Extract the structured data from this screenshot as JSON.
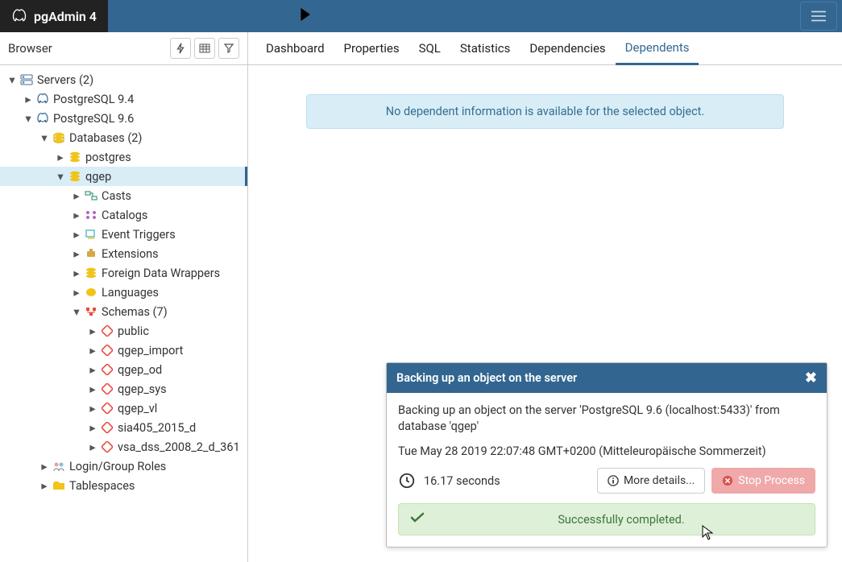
{
  "brand": "pgAdmin 4",
  "browser_title": "Browser",
  "tabs": [
    "Dashboard",
    "Properties",
    "SQL",
    "Statistics",
    "Dependencies",
    "Dependents"
  ],
  "active_tab": "Dependents",
  "alert_text": "No dependent information is available for the selected object.",
  "tree": {
    "servers": "Servers (2)",
    "pg94": "PostgreSQL 9.4",
    "pg96": "PostgreSQL 9.6",
    "databases": "Databases (2)",
    "db_postgres": "postgres",
    "db_qgep": "qgep",
    "casts": "Casts",
    "catalogs": "Catalogs",
    "event_triggers": "Event Triggers",
    "extensions": "Extensions",
    "fdw": "Foreign Data Wrappers",
    "languages": "Languages",
    "schemas": "Schemas (7)",
    "schema_public": "public",
    "schema_qgep_import": "qgep_import",
    "schema_qgep_od": "qgep_od",
    "schema_qgep_sys": "qgep_sys",
    "schema_qgep_vl": "qgep_vl",
    "schema_sia405": "sia405_2015_d",
    "schema_vsa": "vsa_dss_2008_2_d_361",
    "login_roles": "Login/Group Roles",
    "tablespaces": "Tablespaces"
  },
  "popup": {
    "title": "Backing up an object on the server",
    "line1": "Backing up an object on the server 'PostgreSQL 9.6 (localhost:5433)' from database 'qgep'",
    "line2": "Tue May 28 2019 22:07:48 GMT+0200 (Mitteleuropäische Sommerzeit)",
    "elapsed": "16.17 seconds",
    "more_details": "More details...",
    "stop_process": "Stop Process",
    "success": "Successfully completed."
  }
}
